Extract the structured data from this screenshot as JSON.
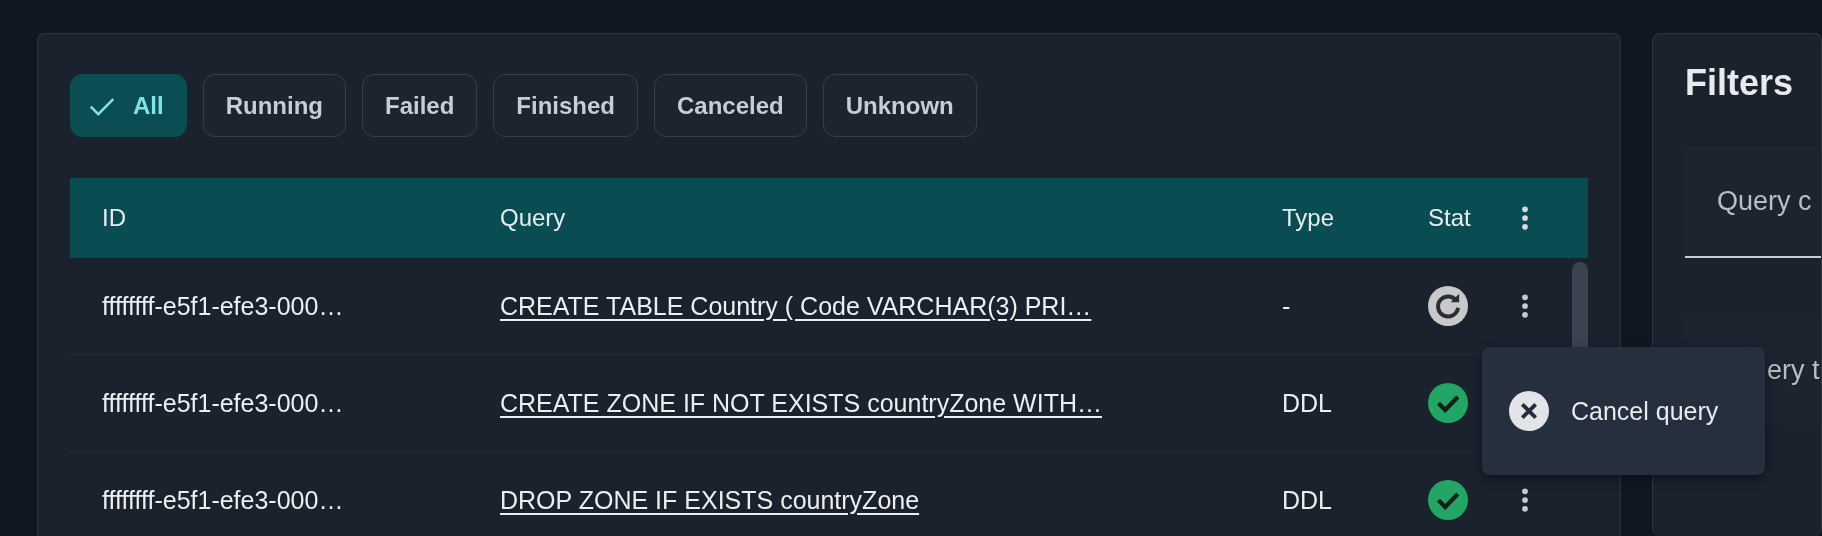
{
  "status_filters": [
    {
      "label": "All",
      "selected": true
    },
    {
      "label": "Running",
      "selected": false
    },
    {
      "label": "Failed",
      "selected": false
    },
    {
      "label": "Finished",
      "selected": false
    },
    {
      "label": "Canceled",
      "selected": false
    },
    {
      "label": "Unknown",
      "selected": false
    }
  ],
  "table": {
    "columns": [
      "ID",
      "Query",
      "Type",
      "Stat"
    ],
    "rows": [
      {
        "id": "ffffffff-e5f1-efe3-000…",
        "query": "CREATE TABLE Country ( Code VARCHAR(3) PRI…",
        "type": "-",
        "kind": "running",
        "actions_button": true
      },
      {
        "id": "ffffffff-e5f1-efe3-000…",
        "query": "CREATE ZONE IF NOT EXISTS countryZone WITH…",
        "type": "DDL",
        "kind": "finished",
        "actions_button": false
      },
      {
        "id": "ffffffff-e5f1-efe3-000…",
        "query": "DROP ZONE IF EXISTS countryZone",
        "type": "DDL",
        "kind": "finished",
        "actions_button": true
      }
    ]
  },
  "context_menu": {
    "items": [
      {
        "label": "Cancel query"
      }
    ]
  },
  "filters_panel": {
    "title": "Filters",
    "fields": [
      {
        "label": "Query c"
      },
      {
        "label": "ery t"
      }
    ]
  }
}
